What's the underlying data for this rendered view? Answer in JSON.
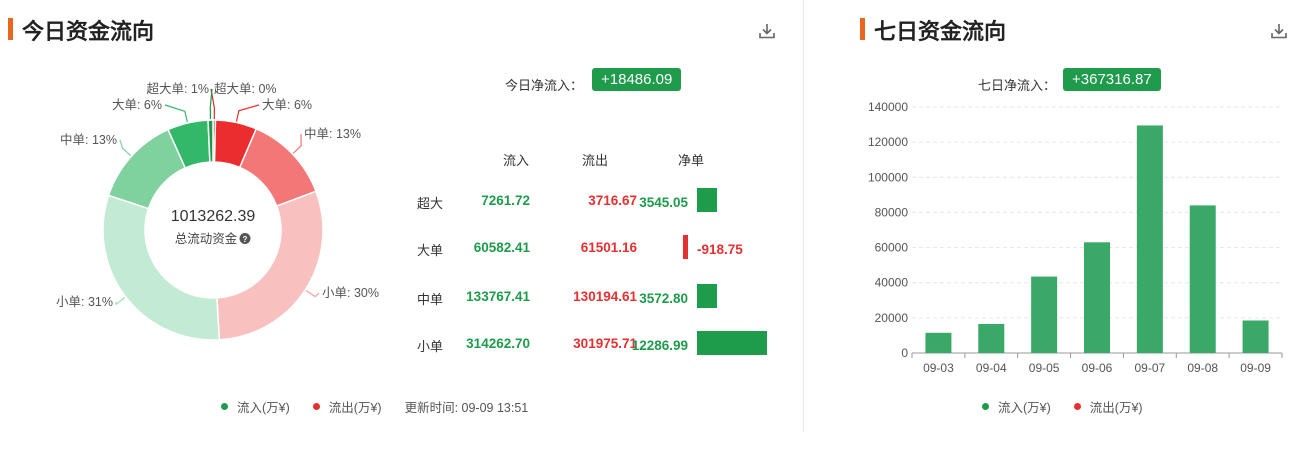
{
  "today": {
    "title": "今日资金流向",
    "net_label": "今日净流入：",
    "net_value": "+18486.09",
    "total_value": "1013262.39",
    "total_label": "总流动资金",
    "table": {
      "headers": [
        "流入",
        "流出",
        "净单"
      ],
      "rows": [
        {
          "label": "超大",
          "in": "7261.72",
          "out": "3716.67",
          "net": "3545.05",
          "net_num": 3545.05
        },
        {
          "label": "大单",
          "in": "60582.41",
          "out": "61501.16",
          "net": "-918.75",
          "net_num": -918.75
        },
        {
          "label": "中单",
          "in": "133767.41",
          "out": "130194.61",
          "net": "3572.80",
          "net_num": 3572.8
        },
        {
          "label": "小单",
          "in": "314262.70",
          "out": "301975.71",
          "net": "12286.99",
          "net_num": 12286.99
        }
      ]
    },
    "legend": {
      "inflow": "流入(万¥)",
      "outflow": "流出(万¥)",
      "updated": "更新时间: 09-09 13:51"
    }
  },
  "week": {
    "title": "七日资金流向",
    "net_label": "七日净流入：",
    "net_value": "+367316.87",
    "legend": {
      "inflow": "流入(万¥)",
      "outflow": "流出(万¥)"
    }
  },
  "colors": {
    "inflow": "#1e9b4b",
    "outflow": "#e53030",
    "accent": "#e8661e"
  },
  "chart_data": [
    {
      "type": "pie",
      "title": "今日资金流向",
      "center_value": "1013262.39",
      "center_label": "总流动资金",
      "slices": [
        {
          "label": "超大单: 0%",
          "percent": 0.36,
          "color": "#d92b2b"
        },
        {
          "label": "大单: 6%",
          "percent": 6.07,
          "color": "#ec2d2d"
        },
        {
          "label": "中单: 13%",
          "percent": 12.85,
          "color": "#f47777"
        },
        {
          "label": "小单: 30%",
          "percent": 29.8,
          "color": "#f9c0c0"
        },
        {
          "label": "小单: 31%",
          "percent": 31.01,
          "color": "#c3ead3"
        },
        {
          "label": "中单: 13%",
          "percent": 13.2,
          "color": "#7fd19e"
        },
        {
          "label": "大单: 6%",
          "percent": 5.98,
          "color": "#33b86a"
        },
        {
          "label": "超大单: 1%",
          "percent": 0.72,
          "color": "#199a48"
        }
      ]
    },
    {
      "type": "bar",
      "title": "七日资金流向",
      "categories": [
        "09-03",
        "09-04",
        "09-05",
        "09-06",
        "09-07",
        "09-08",
        "09-09"
      ],
      "values": [
        11500,
        16500,
        43500,
        63000,
        129500,
        84000,
        18500
      ],
      "ylim": [
        0,
        140000
      ],
      "yticks": [
        0,
        20000,
        40000,
        60000,
        80000,
        100000,
        120000,
        140000
      ],
      "grid": true,
      "legend": "bottom"
    }
  ]
}
